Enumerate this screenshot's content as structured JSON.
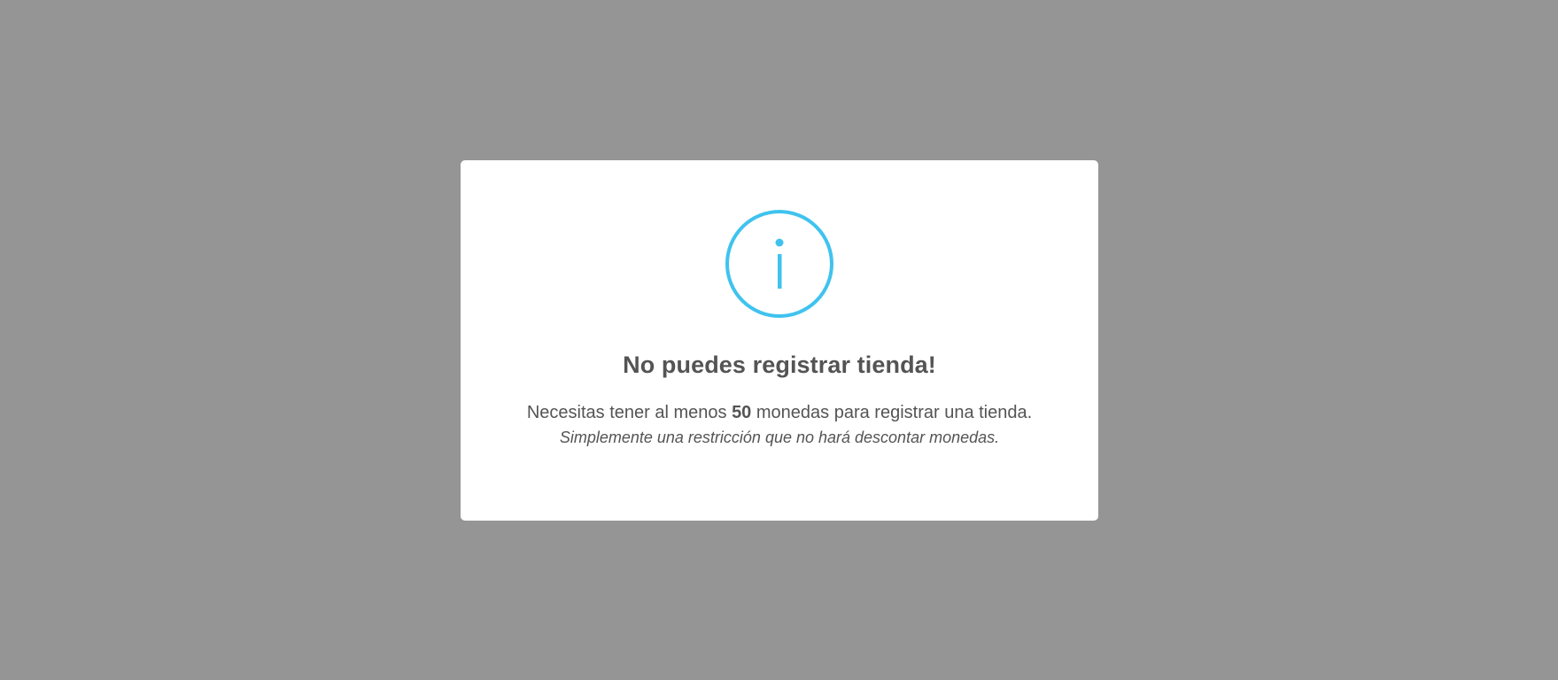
{
  "colors": {
    "backdrop": "#959595",
    "modal_bg": "#ffffff",
    "info_accent": "#3fc3ee",
    "text": "#545454"
  },
  "modal": {
    "icon": "info-icon",
    "icon_glyph": "i",
    "title": "No puedes registrar tienda!",
    "message_prefix": "Necesitas tener al menos ",
    "message_amount": "50",
    "message_suffix": " monedas para registrar una tienda.",
    "note": "Simplemente una restricción que no hará descontar monedas."
  }
}
